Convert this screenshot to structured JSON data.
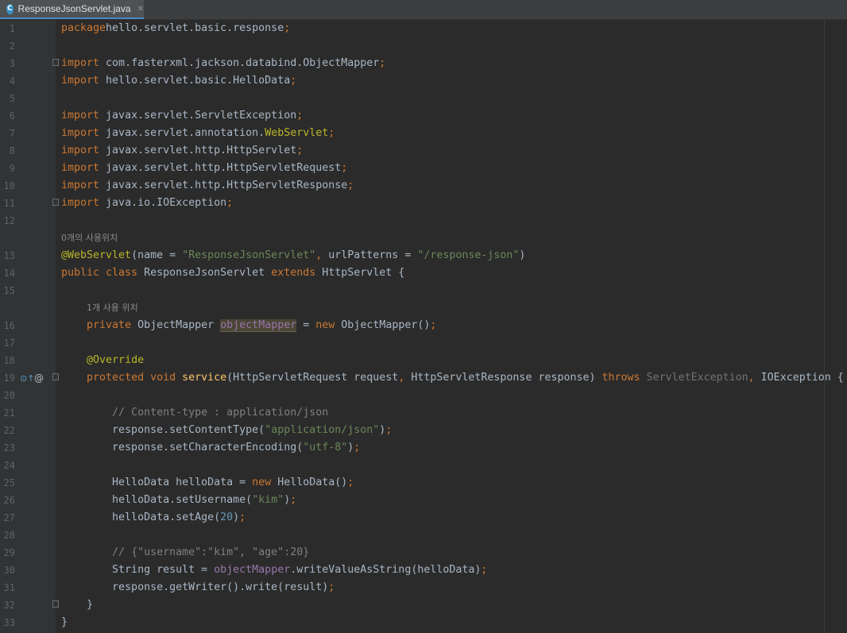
{
  "tab": {
    "title": "ResponseJsonServlet.java",
    "icon_letter": "C",
    "close": "✕"
  },
  "gutter": {
    "override_icon": "⊙↑",
    "annotation_icon": "@"
  },
  "hints": {
    "class_usages": "0개의 사용위치",
    "field_usages": "1개 사용 위치"
  },
  "lines": [
    {
      "n": "1",
      "tokens": [
        [
          "kw",
          "package"
        ],
        [
          "",
          "hello.servlet.basic.response"
        ],
        [
          "kw",
          ";"
        ]
      ]
    },
    {
      "n": "2",
      "tokens": []
    },
    {
      "n": "3",
      "tokens": [
        [
          "kw",
          "import "
        ],
        [
          "",
          "com.fasterxml.jackson.databind.ObjectMapper"
        ],
        [
          "kw",
          ";"
        ]
      ]
    },
    {
      "n": "4",
      "tokens": [
        [
          "kw",
          "import "
        ],
        [
          "",
          "hello.servlet.basic.HelloData"
        ],
        [
          "kw",
          ";"
        ]
      ]
    },
    {
      "n": "5",
      "tokens": []
    },
    {
      "n": "6",
      "tokens": [
        [
          "kw",
          "import "
        ],
        [
          "",
          "javax.servlet.ServletException"
        ],
        [
          "kw",
          ";"
        ]
      ]
    },
    {
      "n": "7",
      "tokens": [
        [
          "kw",
          "import "
        ],
        [
          "",
          "javax.servlet.annotation."
        ],
        [
          "ann",
          "WebServlet"
        ],
        [
          "kw",
          ";"
        ]
      ]
    },
    {
      "n": "8",
      "tokens": [
        [
          "kw",
          "import "
        ],
        [
          "",
          "javax.servlet.http.HttpServlet"
        ],
        [
          "kw",
          ";"
        ]
      ]
    },
    {
      "n": "9",
      "tokens": [
        [
          "kw",
          "import "
        ],
        [
          "",
          "javax.servlet.http.HttpServletRequest"
        ],
        [
          "kw",
          ";"
        ]
      ]
    },
    {
      "n": "10",
      "tokens": [
        [
          "kw",
          "import "
        ],
        [
          "",
          "javax.servlet.http.HttpServletResponse"
        ],
        [
          "kw",
          ";"
        ]
      ]
    },
    {
      "n": "11",
      "tokens": [
        [
          "kw",
          "import "
        ],
        [
          "",
          "java.io.IOException"
        ],
        [
          "kw",
          ";"
        ]
      ]
    },
    {
      "n": "12",
      "tokens": []
    },
    {
      "n": "13",
      "tokens": [
        [
          "ann",
          "@WebServlet"
        ],
        [
          "",
          "(name = "
        ],
        [
          "str",
          "\"ResponseJsonServlet\""
        ],
        [
          "kw",
          ", "
        ],
        [
          "",
          "urlPatterns = "
        ],
        [
          "str",
          "\"/response-json\""
        ],
        [
          "",
          ")"
        ]
      ]
    },
    {
      "n": "14",
      "tokens": [
        [
          "kw",
          "public class "
        ],
        [
          "",
          "ResponseJsonServlet "
        ],
        [
          "kw",
          "extends "
        ],
        [
          "",
          "HttpServlet {"
        ]
      ]
    },
    {
      "n": "15",
      "tokens": []
    },
    {
      "n": "16",
      "tokens": [
        [
          "",
          "    "
        ],
        [
          "kw",
          "private "
        ],
        [
          "",
          "ObjectMapper "
        ],
        [
          "fld hl",
          "objectMapper"
        ],
        [
          "",
          " = "
        ],
        [
          "kw",
          "new "
        ],
        [
          "",
          "ObjectMapper()"
        ],
        [
          "kw",
          ";"
        ]
      ]
    },
    {
      "n": "17",
      "tokens": []
    },
    {
      "n": "18",
      "tokens": [
        [
          "",
          "    "
        ],
        [
          "ann",
          "@Override"
        ]
      ]
    },
    {
      "n": "19",
      "tokens": [
        [
          "",
          "    "
        ],
        [
          "kw",
          "protected void "
        ],
        [
          "fn",
          "service"
        ],
        [
          "",
          "(HttpServletRequest request"
        ],
        [
          "kw",
          ", "
        ],
        [
          "",
          "HttpServletResponse response) "
        ],
        [
          "kw",
          "throws "
        ],
        [
          "unused",
          "ServletException"
        ],
        [
          "kw",
          ", "
        ],
        [
          "",
          "IOException {"
        ]
      ]
    },
    {
      "n": "20",
      "tokens": []
    },
    {
      "n": "21",
      "tokens": [
        [
          "",
          "        "
        ],
        [
          "cmt",
          "// Content-type : application/json"
        ]
      ]
    },
    {
      "n": "22",
      "tokens": [
        [
          "",
          "        response.setContentType("
        ],
        [
          "str",
          "\"application/json\""
        ],
        [
          "",
          ")"
        ],
        [
          "kw",
          ";"
        ]
      ]
    },
    {
      "n": "23",
      "tokens": [
        [
          "",
          "        response.setCharacterEncoding("
        ],
        [
          "str",
          "\"utf-8\""
        ],
        [
          "",
          ")"
        ],
        [
          "kw",
          ";"
        ]
      ]
    },
    {
      "n": "24",
      "tokens": []
    },
    {
      "n": "25",
      "tokens": [
        [
          "",
          "        HelloData helloData = "
        ],
        [
          "kw",
          "new "
        ],
        [
          "",
          "HelloData()"
        ],
        [
          "kw",
          ";"
        ]
      ]
    },
    {
      "n": "26",
      "tokens": [
        [
          "",
          "        helloData.setUsername("
        ],
        [
          "str",
          "\"kim\""
        ],
        [
          "",
          ")"
        ],
        [
          "kw",
          ";"
        ]
      ]
    },
    {
      "n": "27",
      "tokens": [
        [
          "",
          "        helloData.setAge("
        ],
        [
          "num",
          "20"
        ],
        [
          "",
          ")"
        ],
        [
          "kw",
          ";"
        ]
      ]
    },
    {
      "n": "28",
      "tokens": []
    },
    {
      "n": "29",
      "tokens": [
        [
          "",
          "        "
        ],
        [
          "cmt",
          "// {\"username\":\"kim\", \"age\":20}"
        ]
      ]
    },
    {
      "n": "30",
      "tokens": [
        [
          "",
          "        String result = "
        ],
        [
          "fld",
          "objectMapper"
        ],
        [
          "",
          ".writeValueAsString(helloData)"
        ],
        [
          "kw",
          ";"
        ]
      ]
    },
    {
      "n": "31",
      "tokens": [
        [
          "",
          "        response.getWriter().write(result)"
        ],
        [
          "kw",
          ";"
        ]
      ]
    },
    {
      "n": "32",
      "tokens": [
        [
          "",
          "    }"
        ]
      ]
    },
    {
      "n": "33",
      "tokens": [
        [
          "",
          "}"
        ]
      ]
    }
  ]
}
